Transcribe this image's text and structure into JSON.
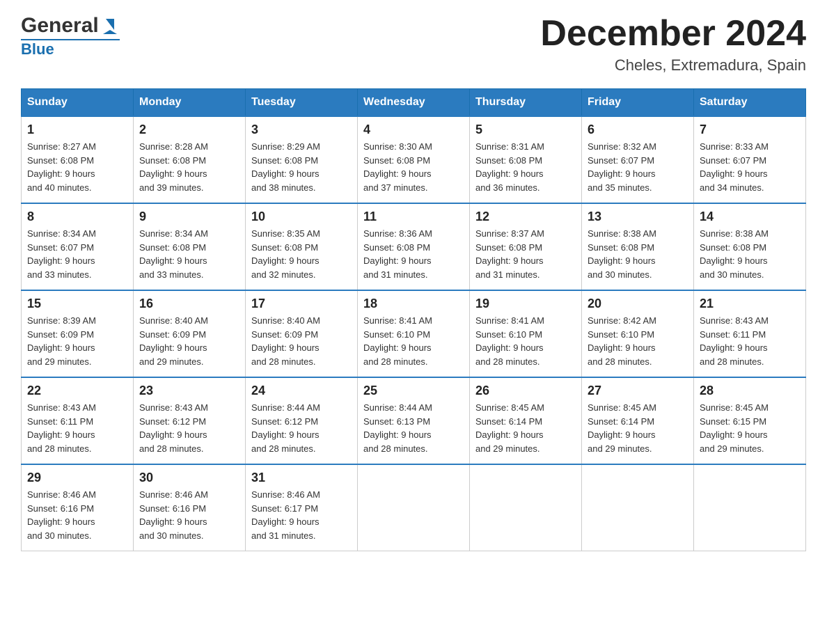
{
  "header": {
    "logo_general": "General",
    "logo_blue": "Blue",
    "main_title": "December 2024",
    "subtitle": "Cheles, Extremadura, Spain"
  },
  "calendar": {
    "days_of_week": [
      "Sunday",
      "Monday",
      "Tuesday",
      "Wednesday",
      "Thursday",
      "Friday",
      "Saturday"
    ],
    "weeks": [
      [
        {
          "day": "1",
          "sunrise": "8:27 AM",
          "sunset": "6:08 PM",
          "daylight": "9 hours and 40 minutes."
        },
        {
          "day": "2",
          "sunrise": "8:28 AM",
          "sunset": "6:08 PM",
          "daylight": "9 hours and 39 minutes."
        },
        {
          "day": "3",
          "sunrise": "8:29 AM",
          "sunset": "6:08 PM",
          "daylight": "9 hours and 38 minutes."
        },
        {
          "day": "4",
          "sunrise": "8:30 AM",
          "sunset": "6:08 PM",
          "daylight": "9 hours and 37 minutes."
        },
        {
          "day": "5",
          "sunrise": "8:31 AM",
          "sunset": "6:08 PM",
          "daylight": "9 hours and 36 minutes."
        },
        {
          "day": "6",
          "sunrise": "8:32 AM",
          "sunset": "6:07 PM",
          "daylight": "9 hours and 35 minutes."
        },
        {
          "day": "7",
          "sunrise": "8:33 AM",
          "sunset": "6:07 PM",
          "daylight": "9 hours and 34 minutes."
        }
      ],
      [
        {
          "day": "8",
          "sunrise": "8:34 AM",
          "sunset": "6:07 PM",
          "daylight": "9 hours and 33 minutes."
        },
        {
          "day": "9",
          "sunrise": "8:34 AM",
          "sunset": "6:08 PM",
          "daylight": "9 hours and 33 minutes."
        },
        {
          "day": "10",
          "sunrise": "8:35 AM",
          "sunset": "6:08 PM",
          "daylight": "9 hours and 32 minutes."
        },
        {
          "day": "11",
          "sunrise": "8:36 AM",
          "sunset": "6:08 PM",
          "daylight": "9 hours and 31 minutes."
        },
        {
          "day": "12",
          "sunrise": "8:37 AM",
          "sunset": "6:08 PM",
          "daylight": "9 hours and 31 minutes."
        },
        {
          "day": "13",
          "sunrise": "8:38 AM",
          "sunset": "6:08 PM",
          "daylight": "9 hours and 30 minutes."
        },
        {
          "day": "14",
          "sunrise": "8:38 AM",
          "sunset": "6:08 PM",
          "daylight": "9 hours and 30 minutes."
        }
      ],
      [
        {
          "day": "15",
          "sunrise": "8:39 AM",
          "sunset": "6:09 PM",
          "daylight": "9 hours and 29 minutes."
        },
        {
          "day": "16",
          "sunrise": "8:40 AM",
          "sunset": "6:09 PM",
          "daylight": "9 hours and 29 minutes."
        },
        {
          "day": "17",
          "sunrise": "8:40 AM",
          "sunset": "6:09 PM",
          "daylight": "9 hours and 28 minutes."
        },
        {
          "day": "18",
          "sunrise": "8:41 AM",
          "sunset": "6:10 PM",
          "daylight": "9 hours and 28 minutes."
        },
        {
          "day": "19",
          "sunrise": "8:41 AM",
          "sunset": "6:10 PM",
          "daylight": "9 hours and 28 minutes."
        },
        {
          "day": "20",
          "sunrise": "8:42 AM",
          "sunset": "6:10 PM",
          "daylight": "9 hours and 28 minutes."
        },
        {
          "day": "21",
          "sunrise": "8:43 AM",
          "sunset": "6:11 PM",
          "daylight": "9 hours and 28 minutes."
        }
      ],
      [
        {
          "day": "22",
          "sunrise": "8:43 AM",
          "sunset": "6:11 PM",
          "daylight": "9 hours and 28 minutes."
        },
        {
          "day": "23",
          "sunrise": "8:43 AM",
          "sunset": "6:12 PM",
          "daylight": "9 hours and 28 minutes."
        },
        {
          "day": "24",
          "sunrise": "8:44 AM",
          "sunset": "6:12 PM",
          "daylight": "9 hours and 28 minutes."
        },
        {
          "day": "25",
          "sunrise": "8:44 AM",
          "sunset": "6:13 PM",
          "daylight": "9 hours and 28 minutes."
        },
        {
          "day": "26",
          "sunrise": "8:45 AM",
          "sunset": "6:14 PM",
          "daylight": "9 hours and 29 minutes."
        },
        {
          "day": "27",
          "sunrise": "8:45 AM",
          "sunset": "6:14 PM",
          "daylight": "9 hours and 29 minutes."
        },
        {
          "day": "28",
          "sunrise": "8:45 AM",
          "sunset": "6:15 PM",
          "daylight": "9 hours and 29 minutes."
        }
      ],
      [
        {
          "day": "29",
          "sunrise": "8:46 AM",
          "sunset": "6:16 PM",
          "daylight": "9 hours and 30 minutes."
        },
        {
          "day": "30",
          "sunrise": "8:46 AM",
          "sunset": "6:16 PM",
          "daylight": "9 hours and 30 minutes."
        },
        {
          "day": "31",
          "sunrise": "8:46 AM",
          "sunset": "6:17 PM",
          "daylight": "9 hours and 31 minutes."
        },
        null,
        null,
        null,
        null
      ]
    ],
    "labels": {
      "sunrise": "Sunrise:",
      "sunset": "Sunset:",
      "daylight": "Daylight:"
    }
  }
}
